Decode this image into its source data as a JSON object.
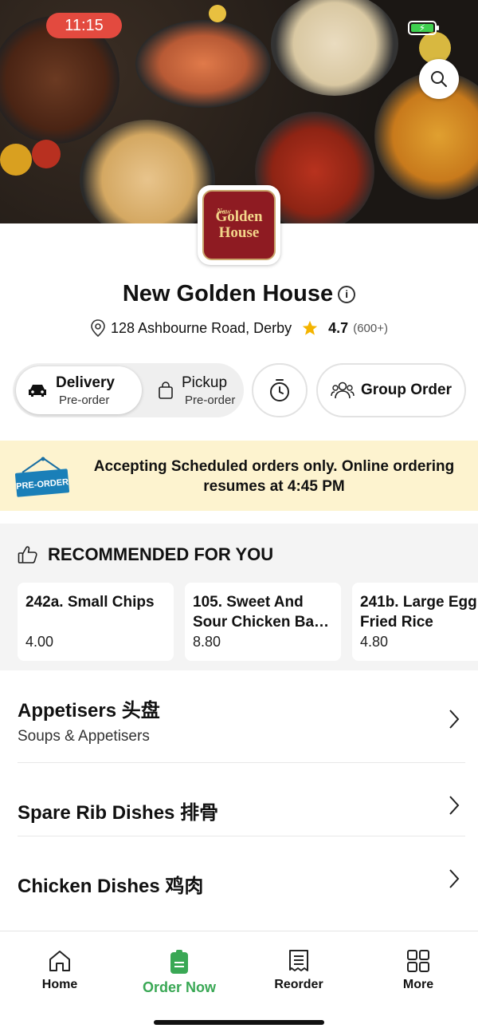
{
  "status_bar": {
    "time": "11:15"
  },
  "restaurant": {
    "logo_text": {
      "small": "New",
      "line1": "Golden",
      "line2": "House"
    },
    "name": "New Golden House",
    "address": "128 Ashbourne Road, Derby",
    "rating": "4.7",
    "rating_count": "(600+)"
  },
  "order_modes": {
    "delivery": {
      "label": "Delivery",
      "sub": "Pre-order"
    },
    "pickup": {
      "label": "Pickup",
      "sub": "Pre-order"
    }
  },
  "group_order_label": "Group Order",
  "banner": {
    "sign_text": "PRE-ORDER",
    "message": "Accepting Scheduled orders only. Online ordering resumes at 4:45 PM"
  },
  "recommended": {
    "title": "RECOMMENDED FOR YOU",
    "items": [
      {
        "name": "242a. Small Chips",
        "price": "4.00"
      },
      {
        "name": "105. Sweet And Sour Chicken Ba…",
        "price": "8.80"
      },
      {
        "name": "241b. Large Egg Fried Rice",
        "price": "4.80"
      }
    ]
  },
  "categories": [
    {
      "title": "Appetisers 头盘",
      "subtitle": "Soups & Appetisers"
    },
    {
      "title": "Spare Rib Dishes 排骨",
      "subtitle": ""
    },
    {
      "title": "Chicken Dishes 鸡肉",
      "subtitle": ""
    }
  ],
  "tabs": [
    {
      "label": "Home",
      "icon": "home-icon"
    },
    {
      "label": "Order Now",
      "icon": "order-bag-icon"
    },
    {
      "label": "Reorder",
      "icon": "receipt-icon"
    },
    {
      "label": "More",
      "icon": "grid-icon"
    }
  ],
  "colors": {
    "accent_green": "#3aa855",
    "banner_bg": "#fdf3cf",
    "brand_red": "#8e1b22",
    "star": "#f4b400"
  }
}
